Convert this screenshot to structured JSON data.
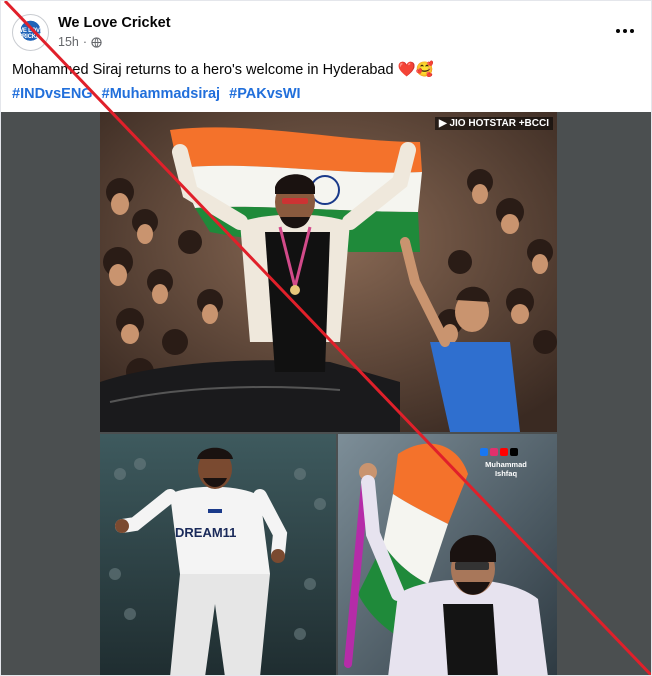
{
  "page": {
    "name": "We Love Cricket",
    "avatar_text": "WE LOVE CRICKET",
    "timestamp": "15h",
    "privacy_icon": "globe-icon",
    "more_icon": "more-options-icon"
  },
  "post": {
    "caption": "Mohammed Siraj returns to a hero's welcome in Hyderabad ❤️🥰",
    "hashtags": [
      "#INDvsENG",
      "#Muhammadsiraj",
      "#PAKvsWI"
    ]
  },
  "media": {
    "top_watermark": "▶ JIO HOTSTAR +BCCI",
    "jersey_text": "DREAM11",
    "br_watermark_line1": "Muhammad",
    "br_watermark_line2": "Ishfaq"
  },
  "colors": {
    "hashtag": "#216fdb",
    "strike_line": "#e0202a",
    "saffron": "#f4722b",
    "india_green": "#1f8a3a"
  }
}
